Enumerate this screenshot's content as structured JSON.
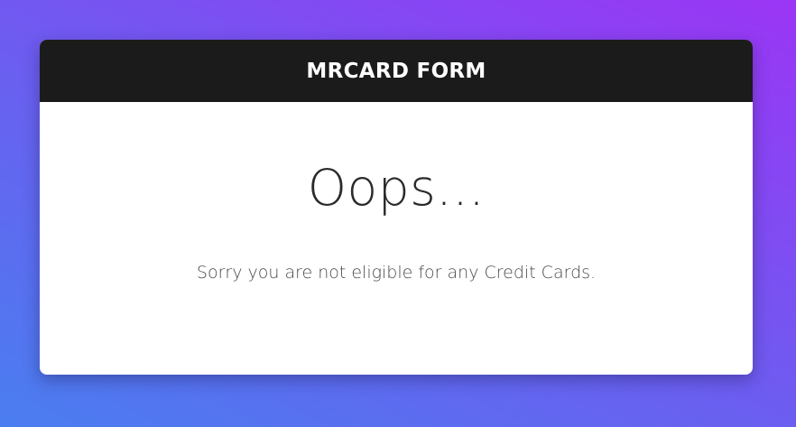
{
  "form": {
    "title": "MRCARD FORM",
    "heading": "Oops...",
    "message": "Sorry you are not eligible for any Credit Cards."
  },
  "colors": {
    "gradient_start": "#4a7ef0",
    "gradient_end": "#9b35f5",
    "header_background": "#1b1b1b",
    "card_background": "#ffffff"
  }
}
